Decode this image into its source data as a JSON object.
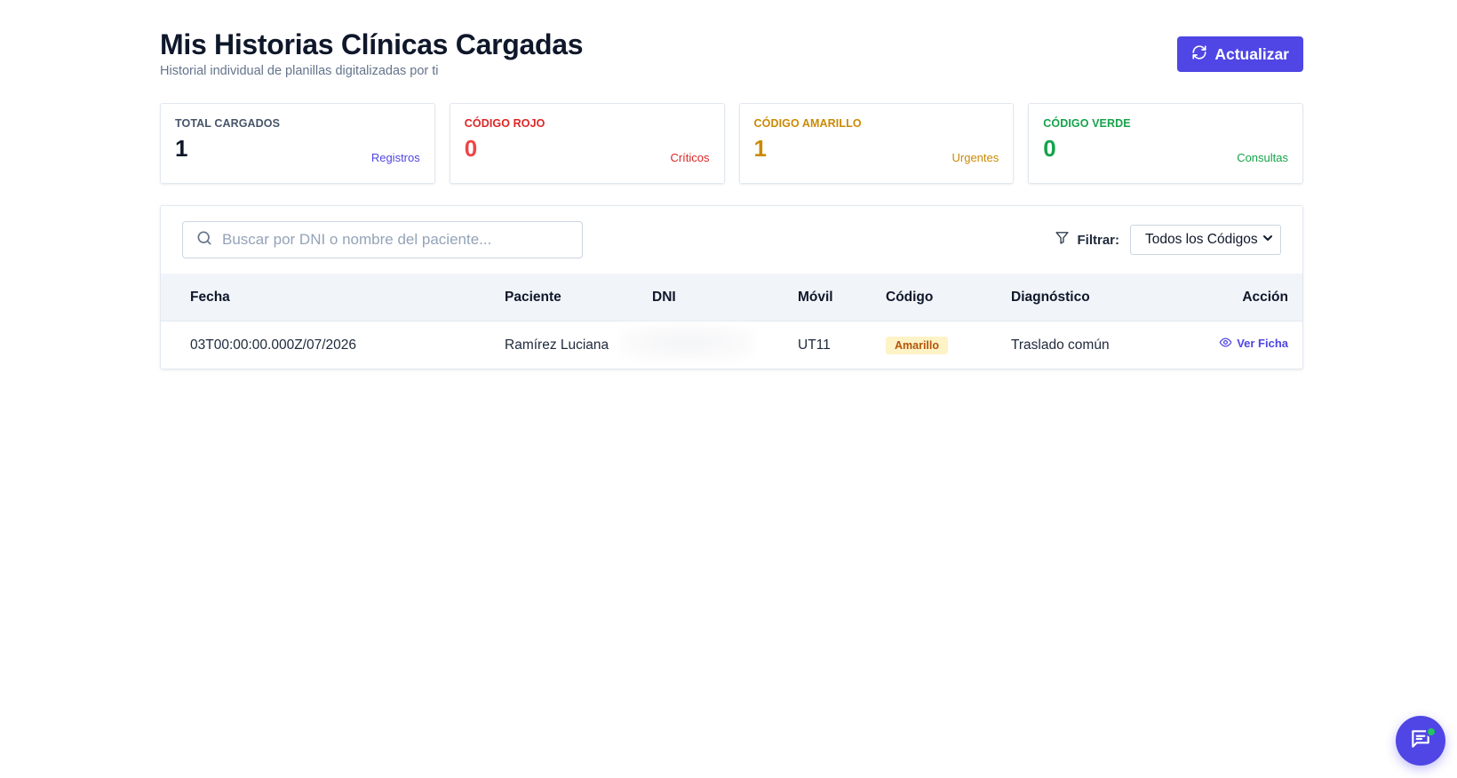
{
  "header": {
    "title": "Mis Historias Clínicas Cargadas",
    "subtitle": "Historial individual de planillas digitalizadas por ti",
    "refresh_label": "Actualizar"
  },
  "stats": [
    {
      "label": "TOTAL CARGADOS",
      "value": "1",
      "sub": "Registros",
      "color": "#0f172a",
      "label_color": "#475569",
      "sub_color": "#4f46e5"
    },
    {
      "label": "CÓDIGO ROJO",
      "value": "0",
      "sub": "Críticos",
      "color": "#ef4444",
      "label_color": "#dc2626",
      "sub_color": "#dc2626"
    },
    {
      "label": "CÓDIGO AMARILLO",
      "value": "1",
      "sub": "Urgentes",
      "color": "#ca8a04",
      "label_color": "#ca8a04",
      "sub_color": "#ca8a04"
    },
    {
      "label": "CÓDIGO VERDE",
      "value": "0",
      "sub": "Consultas",
      "color": "#16a34a",
      "label_color": "#16a34a",
      "sub_color": "#16a34a"
    }
  ],
  "toolbar": {
    "search_placeholder": "Buscar por DNI o nombre del paciente...",
    "search_value": "",
    "filter_label": "Filtrar:",
    "filter_selected": "Todos los Códigos"
  },
  "table": {
    "headers": {
      "fecha": "Fecha",
      "paciente": "Paciente",
      "dni": "DNI",
      "movil": "Móvil",
      "codigo": "Código",
      "diagnostico": "Diagnóstico",
      "accion": "Acción"
    },
    "rows": [
      {
        "fecha": "03T00:00:00.000Z/07/2026",
        "paciente": "Ramírez Luciana",
        "dni": "",
        "movil": "UT11",
        "codigo": "Amarillo",
        "diagnostico": "Traslado común",
        "accion": "Ver Ficha"
      }
    ]
  },
  "colors": {
    "accent": "#4f46e5",
    "badge_bg": "#fef3c7",
    "badge_text": "#b45309",
    "chat_status": "#22c55e"
  },
  "icons": {
    "refresh": "refresh-icon",
    "search": "search-icon",
    "filter": "filter-icon",
    "dropdown": "chevron-down-icon",
    "view": "eye-icon",
    "chat": "chat-icon"
  }
}
